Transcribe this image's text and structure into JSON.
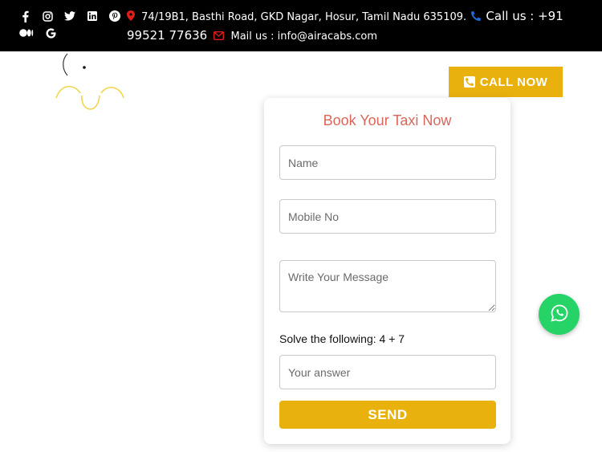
{
  "topbar": {
    "social_icons": [
      "facebook-icon",
      "instagram-icon",
      "twitter-icon",
      "linkedin-icon",
      "pinterest-icon",
      "medium-icon",
      "google-icon"
    ],
    "address": "74/19B1, Basthi Road, GKD Nagar, Hosur, Tamil Nadu 635109.",
    "call_label": "Call us : +91 99521 77636",
    "mail_label": "Mail us : info@airacabs.com"
  },
  "header": {
    "call_now": "CALL NOW"
  },
  "booking_form": {
    "title": "Book Your Taxi Now",
    "name_placeholder": "Name",
    "mobile_placeholder": "Mobile No",
    "message_placeholder": "Write Your Message",
    "captcha_question": "Solve the following: 4 + 7",
    "answer_placeholder": "Your answer",
    "send_label": "SEND"
  },
  "colors": {
    "accent": "#e9b10d",
    "title": "#d9665b",
    "topbar": "#000000",
    "whatsapp": "#25d366"
  }
}
